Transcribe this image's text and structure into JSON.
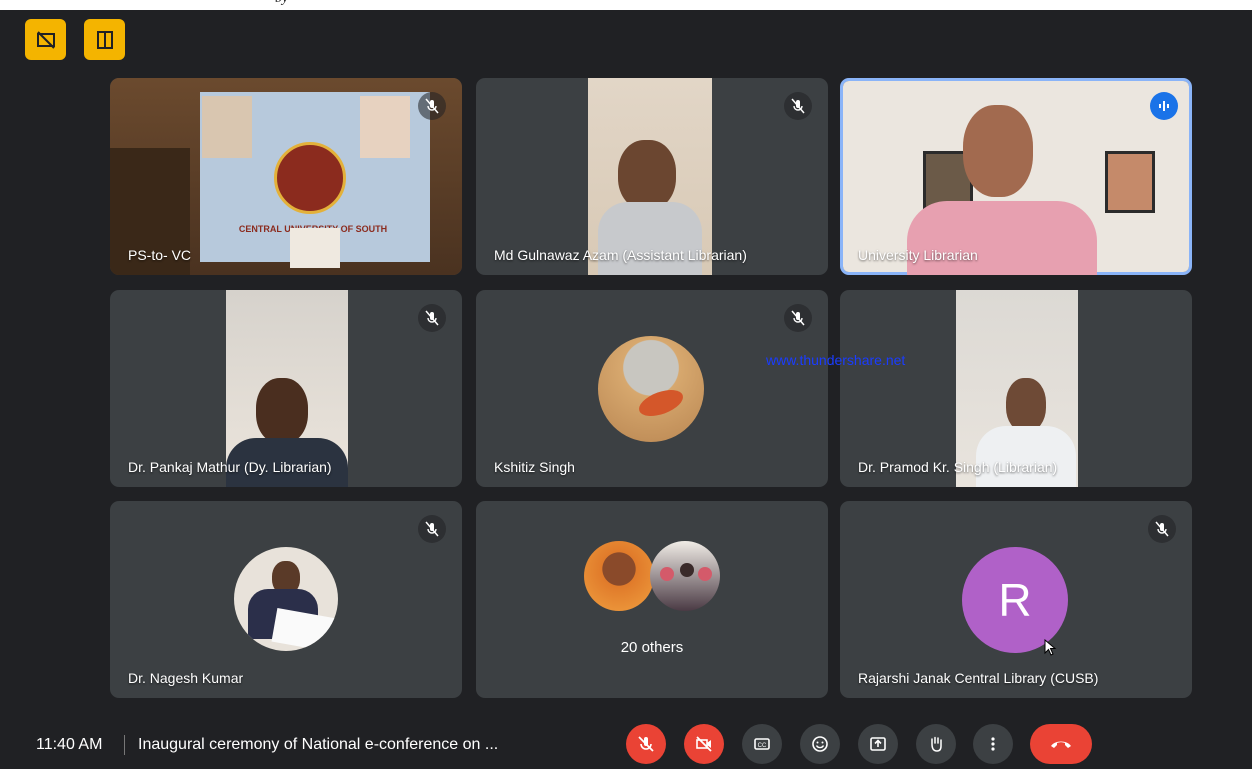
{
  "top_caption": "by",
  "tiles": [
    {
      "name": "PS-to- VC",
      "muted": true
    },
    {
      "name": "Md Gulnawaz Azam (Assistant Librarian)",
      "muted": true
    },
    {
      "name": "University Librarian",
      "speaking": true
    },
    {
      "name": "Dr. Pankaj Mathur (Dy. Librarian)",
      "muted": true
    },
    {
      "name": "Kshitiz Singh",
      "muted": true
    },
    {
      "name": "Dr. Pramod Kr. Singh (Librarian)",
      "muted": false
    },
    {
      "name": "Dr. Nagesh Kumar",
      "muted": true
    },
    {
      "name": "20 others"
    },
    {
      "name": "Rajarshi Janak Central Library (CUSB)",
      "muted": true,
      "avatar_letter": "R",
      "avatar_color": "#b061c8"
    }
  ],
  "banner_text": "CENTRAL UNIVERSITY OF SOUTH BIHAR",
  "watermark": "www.thundershare.net",
  "bottom": {
    "time": "11:40 AM",
    "meeting_title": "Inaugural ceremony of National e-conference on ..."
  },
  "colors": {
    "accent_yellow": "#f4b400",
    "danger": "#ea4335",
    "tile_bg": "#3c4043",
    "speaking_blue": "#1a73e8"
  },
  "controls": [
    "mic-off-icon",
    "camera-off-icon",
    "captions-icon",
    "emoji-icon",
    "present-icon",
    "raise-hand-icon",
    "more-icon",
    "end-call-icon"
  ]
}
